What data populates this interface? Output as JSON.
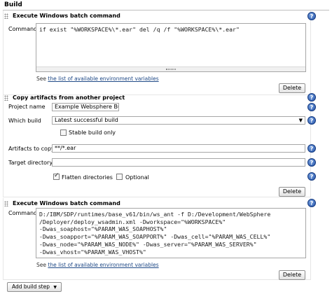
{
  "section": {
    "title": "Build"
  },
  "help_glyph": "?",
  "env_note": {
    "prefix": "See ",
    "link": "the list of available environment variables"
  },
  "step1": {
    "title": "Execute Windows batch command",
    "command_label": "Command",
    "command": "if exist \"%WORKSPACE%\\*.ear\" del /q /f \"%WORKSPACE%\\*.ear\"",
    "delete_label": "Delete"
  },
  "step2": {
    "title": "Copy artifacts from another project",
    "project_label": "Project name",
    "project_value": "Example Websphere Bu",
    "which_label": "Which build",
    "which_value": "Latest successful build",
    "stable_label": "Stable build only",
    "artifacts_label": "Artifacts to copy",
    "artifacts_value": "**/*.ear",
    "target_label": "Target directory",
    "target_value": "",
    "flatten_label": "Flatten directories",
    "optional_label": "Optional",
    "delete_label": "Delete"
  },
  "step3": {
    "title": "Execute Windows batch command",
    "command_label": "Command",
    "command": "D:/IBM/SDP/runtimes/base_v61/bin/ws_ant -f D:/Development/WebSphere\n/Deployer/deploy_wsadmin.xml -Dworkspace=\"%WORKSPACE%\"\n-Dwas_soaphost=\"%PARAM_WAS_SOAPHOST%\"\n-Dwas_soapport=\"%PARAM_WAS_SOAPPORT%\" -Dwas_cell=\"%PARAM_WAS_CELL%\"\n-Dwas_node=\"%PARAM_WAS_NODE%\" -Dwas_server=\"%PARAM_WAS_SERVER%\"\n-Dwas_vhost=\"%PARAM_WAS_VHOST%\"",
    "delete_label": "Delete"
  },
  "add_build_step": {
    "label": "Add build step",
    "arrow": "▼"
  },
  "icons": {
    "select_arrow": "▼"
  }
}
